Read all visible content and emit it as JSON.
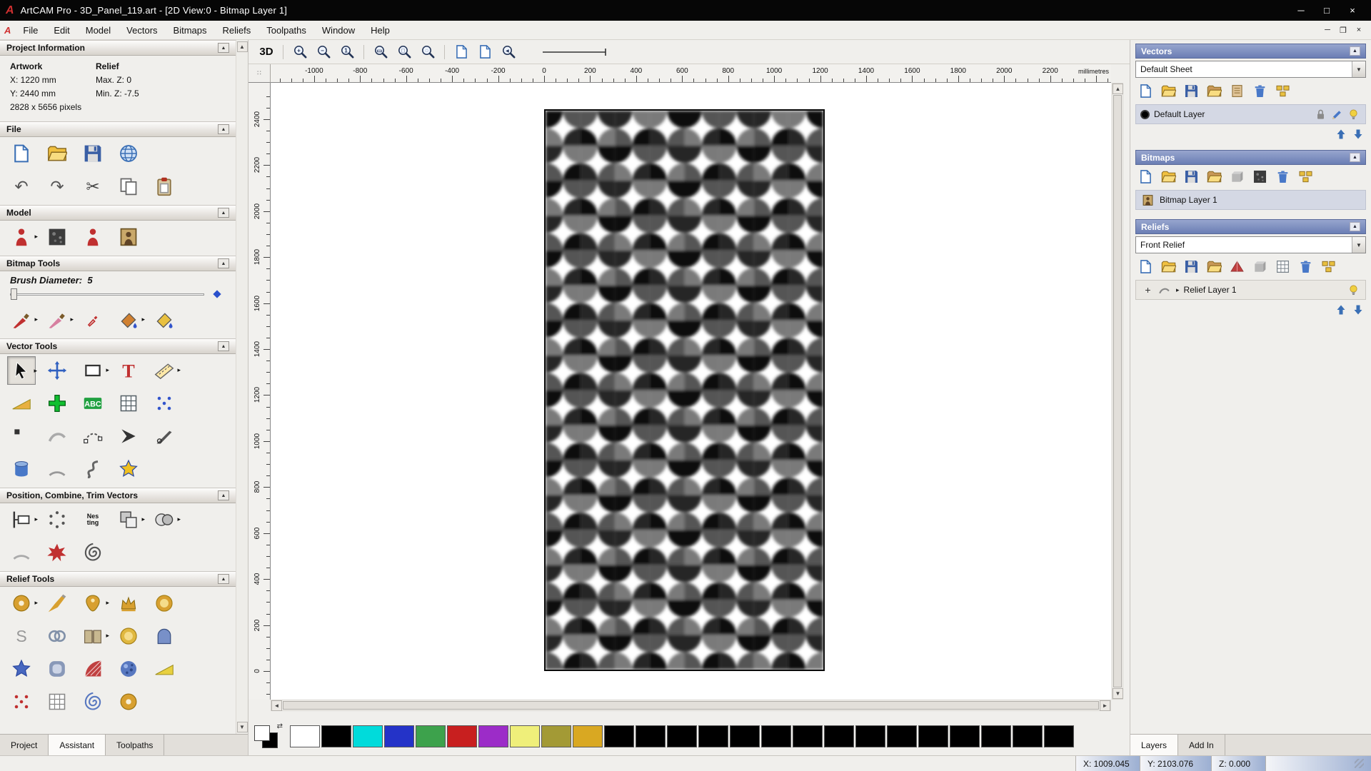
{
  "ui": {
    "collapse_glyph": "▲",
    "dropdown_arrow": "▼",
    "expander_arrow": "▸",
    "flyout_arrow": "▸",
    "scroll_up": "▲",
    "scroll_down": "▼",
    "scroll_left": "◄",
    "scroll_right": "►",
    "corner_glyph": "∷",
    "link_glyph": "⇄"
  },
  "window": {
    "title": "ArtCAM Pro - 3D_Panel_119.art - [2D View:0 - Bitmap Layer 1]",
    "logo_text": "A",
    "controls": [
      {
        "name": "minimize-button",
        "glyph": "─"
      },
      {
        "name": "maximize-button",
        "glyph": "□"
      },
      {
        "name": "close-button",
        "glyph": "×"
      }
    ],
    "mdi_controls": [
      {
        "name": "mdi-minimize-button",
        "glyph": "─"
      },
      {
        "name": "mdi-restore-button",
        "glyph": "❐"
      },
      {
        "name": "mdi-close-button",
        "glyph": "×"
      }
    ]
  },
  "menu": {
    "items": [
      "File",
      "Edit",
      "Model",
      "Vectors",
      "Bitmaps",
      "Reliefs",
      "Toolpaths",
      "Window",
      "Help"
    ]
  },
  "assistant": {
    "project_information": {
      "title": "Project Information",
      "artwork_header": "Artwork",
      "relief_header": "Relief",
      "artwork_x": "X: 1220 mm",
      "artwork_y": "Y: 2440 mm",
      "artwork_pixels": "2828 x 5656 pixels",
      "relief_max_z": "Max. Z: 0",
      "relief_min_z": "Min. Z: -7.5"
    },
    "file": {
      "title": "File",
      "rows": [
        [
          {
            "n": "new-model-button",
            "k": "file",
            "c": "#3a6fb5"
          },
          {
            "n": "open-model-button",
            "k": "folder",
            "c": "#f0c040"
          },
          {
            "n": "save-model-button",
            "k": "floppy",
            "c": "#3a5fa5"
          },
          {
            "n": "export-model-button",
            "k": "globe",
            "c": "#3a6fb5"
          }
        ],
        [
          {
            "n": "undo-button",
            "g": "↶",
            "c": "#555555"
          },
          {
            "n": "redo-button",
            "g": "↷",
            "c": "#555555"
          },
          {
            "n": "cut-button",
            "g": "✂",
            "c": "#444444"
          },
          {
            "n": "copy-button",
            "k": "copy",
            "c": "#666666"
          },
          {
            "n": "paste-button",
            "k": "clip",
            "c": "#b03020"
          }
        ]
      ]
    },
    "model": {
      "title": "Model",
      "rows": [
        [
          {
            "n": "greyscale-from-model-button",
            "k": "person",
            "c": "#c03030",
            "fly": true
          },
          {
            "n": "texture-relief-button",
            "k": "texture"
          },
          {
            "n": "shape-editor-button",
            "k": "person",
            "c": "#c03030"
          },
          {
            "n": "bitmap-from-model-button",
            "k": "portrait"
          }
        ]
      ]
    },
    "bitmap_tools": {
      "title": "Bitmap Tools",
      "brush_diameter_label": "Brush Diameter:",
      "brush_diameter_value": "5",
      "rows": [
        [
          {
            "n": "paint-tool",
            "k": "brush",
            "c": "#c03030",
            "fly": true
          },
          {
            "n": "paint-selective-tool",
            "k": "brush",
            "c": "#d77fa0",
            "fly": true
          },
          {
            "n": "colour-picker-tool",
            "k": "dropper",
            "c": "#c03030",
            "sm": true
          },
          {
            "n": "flood-fill-tool",
            "k": "bucket",
            "c": "#d08030",
            "fly": true
          },
          {
            "n": "bucket-fill-tool",
            "k": "bucket",
            "c": "#e8c040"
          }
        ]
      ]
    },
    "vector_tools": {
      "title": "Vector Tools",
      "rows": [
        [
          {
            "n": "select-vectors-tool",
            "k": "cursor",
            "c": "#111111",
            "fly": true,
            "active": true
          },
          {
            "n": "transform-vectors-tool",
            "k": "movecross",
            "c": "#3060c0"
          },
          {
            "n": "create-rectangle-tool",
            "k": "rect",
            "c": "#333333",
            "fly": true
          },
          {
            "n": "create-text-tool",
            "k": "texttool",
            "c": "#c03030",
            "label": "T"
          },
          {
            "n": "measure-tool",
            "k": "measure",
            "c": "#666666",
            "fly": true
          }
        ],
        [
          {
            "n": "offset-vectors-tool",
            "k": "wedge",
            "c": "#e8b040"
          },
          {
            "n": "create-cross-tool",
            "k": "plus",
            "c": "#10c030"
          },
          {
            "n": "convert-text-to-vectors-tool",
            "k": "abc",
            "c": "#20a040",
            "label": "ABC"
          },
          {
            "n": "snap-grid-tool",
            "k": "grid",
            "c": "#556066"
          },
          {
            "n": "create-polygon-tool",
            "k": "dots",
            "c": "#3355cc"
          }
        ],
        [
          {
            "n": "create-point-tool",
            "k": "smalldot",
            "c": "#333333"
          },
          {
            "n": "freehand-curve-tool",
            "k": "ghostcurve",
            "c": "#aaaaaa"
          },
          {
            "n": "bezier-curve-tool",
            "k": "nodeedit",
            "c": "#555555"
          },
          {
            "n": "create-polyline-tool",
            "k": "polyline",
            "c": "#333333"
          },
          {
            "n": "knife-tool",
            "k": "knife",
            "c": "#555555"
          }
        ],
        [
          {
            "n": "extrude-tool",
            "k": "cylinder",
            "c": "#4878c8"
          },
          {
            "n": "create-arc-tool",
            "k": "arc",
            "c": "#999999"
          },
          {
            "n": "node-editing-tool",
            "k": "scurve",
            "c": "#666666"
          },
          {
            "n": "create-star-tool",
            "k": "star",
            "c": "#f0c020"
          }
        ]
      ]
    },
    "position_tools": {
      "title": "Position, Combine, Trim Vectors",
      "rows": [
        [
          {
            "n": "position-vectors-tool",
            "k": "posl",
            "c": "#333333",
            "fly": true
          },
          {
            "n": "circular-copy-tool",
            "k": "dotcircle",
            "c": "#555555"
          },
          {
            "n": "nesting-tool",
            "k": "nesting",
            "label": "Nes\nting"
          },
          {
            "n": "combine-vectors-tool",
            "k": "combine",
            "fly": true
          },
          {
            "n": "weld-vectors-tool",
            "k": "weld",
            "fly": true
          }
        ],
        [
          {
            "n": "fit-arcs-tool",
            "k": "arc",
            "c": "#aaaaaa"
          },
          {
            "n": "vector-doctor-tool",
            "k": "doctor",
            "c": "#c03030"
          },
          {
            "n": "create-spiral-tool",
            "k": "spiral",
            "c": "#555555"
          }
        ]
      ]
    },
    "relief_tools": {
      "title": "Relief Tools",
      "rows": [
        [
          {
            "n": "texture-relief-wizard",
            "k": "donut",
            "c": "#d8a030",
            "fly": true
          },
          {
            "n": "sculpting-tool",
            "k": "chisel",
            "c": "#d8a030"
          },
          {
            "n": "shape-relief-tool",
            "k": "ornament",
            "c": "#d8a030",
            "fly": true
          },
          {
            "n": "crown-relief-tool",
            "k": "crown",
            "c": "#d8a030"
          },
          {
            "n": "emboss-relief-tool",
            "k": "button",
            "c": "#d8a030"
          }
        ],
        [
          {
            "n": "smooth-relief-tool",
            "g": "S",
            "c": "#999999"
          },
          {
            "n": "weave-relief-tool",
            "k": "knot",
            "c": "#8090a8"
          },
          {
            "n": "offset-relief-tool",
            "k": "book",
            "c": "#c8b890",
            "fly": true
          },
          {
            "n": "dome-relief-tool",
            "k": "button",
            "c": "#e0b840"
          },
          {
            "n": "turn-relief-tool",
            "k": "arch",
            "c": "#7890c8"
          }
        ],
        [
          {
            "n": "star-relief-tool",
            "k": "star",
            "c": "#4868c0"
          },
          {
            "n": "cushion-relief-tool",
            "k": "cushion",
            "c": "#8898b8"
          },
          {
            "n": "fan-relief-tool",
            "k": "fan",
            "c": "#c04040"
          },
          {
            "n": "texture-sphere-tool",
            "k": "sphere",
            "c": "#5878c0"
          },
          {
            "n": "wedge-relief-tool",
            "k": "wedge",
            "c": "#e8d040"
          }
        ],
        [
          {
            "n": "scatter-relief-tool",
            "k": "dots",
            "c": "#c03030"
          },
          {
            "n": "mesh-relief-tool",
            "k": "grid",
            "c": "#888888"
          },
          {
            "n": "swirl-relief-tool",
            "k": "spiral",
            "c": "#5878c0"
          },
          {
            "n": "ornament-relief-tool",
            "k": "donut",
            "c": "#d8a030"
          }
        ]
      ]
    },
    "tabs": [
      {
        "name": "tab-project",
        "label": "Project"
      },
      {
        "name": "tab-assistant",
        "label": "Assistant",
        "active": true
      },
      {
        "name": "tab-toolpaths",
        "label": "Toolpaths"
      }
    ]
  },
  "view_toolbar": {
    "buttons": [
      {
        "n": "view-3d-button",
        "label": "3D"
      },
      {
        "sep": true
      },
      {
        "n": "zoom-in-button",
        "k": "mag",
        "t": "+"
      },
      {
        "n": "zoom-out-button",
        "k": "mag",
        "t": "−"
      },
      {
        "n": "zoom-1to1-button",
        "k": "mag",
        "t": "1"
      },
      {
        "sep": true
      },
      {
        "n": "zoom-page-button",
        "k": "mag",
        "t": "▭"
      },
      {
        "n": "zoom-objects-button",
        "k": "mag",
        "t": "□"
      },
      {
        "n": "zoom-selection-button",
        "k": "mag",
        "t": "◌"
      },
      {
        "sep": true
      },
      {
        "n": "previous-view-button",
        "k": "file",
        "c": "#3a6fb5"
      },
      {
        "n": "next-view-button",
        "k": "file",
        "c": "#3a6fb5"
      },
      {
        "n": "zoom-back-button",
        "k": "mag",
        "t": "◂"
      }
    ]
  },
  "rulers": {
    "unit": "millimetres",
    "horizontal_labels": [
      -1000,
      -800,
      -600,
      -400,
      -200,
      0,
      200,
      400,
      600,
      800,
      1000,
      1200,
      1400,
      1600,
      1800,
      2000,
      2200
    ],
    "vertical_labels": [
      2400,
      2200,
      2000,
      1800,
      1600,
      1400,
      1200,
      1000,
      800,
      600,
      400,
      200,
      0
    ]
  },
  "canvas": {
    "pattern_colors": [
      "#0d0d0d",
      "#555555",
      "#262626",
      "#7a7a7a"
    ]
  },
  "palette": {
    "swatches": [
      "#ffffff",
      "#000000",
      "#00dbdb",
      "#2433c8",
      "#3da24c",
      "#c81f1f",
      "#9c2cc8",
      "#efef7a",
      "#a39a35",
      "#d9a822",
      "#000000",
      "#000000",
      "#000000",
      "#000000",
      "#000000",
      "#000000",
      "#000000",
      "#000000",
      "#000000",
      "#000000",
      "#000000",
      "#000000",
      "#000000",
      "#000000",
      "#000000"
    ]
  },
  "panels": {
    "vectors": {
      "title": "Vectors",
      "sheet_value": "Default Sheet",
      "toolbar": [
        {
          "n": "new-vector-layer-button",
          "k": "file",
          "c": "#3a6fb5"
        },
        {
          "n": "open-vector-layer-button",
          "k": "folder",
          "c": "#f0c040"
        },
        {
          "n": "save-vector-layer-button",
          "k": "floppy",
          "c": "#3a5fa5"
        },
        {
          "n": "import-vector-layer-button",
          "k": "folder",
          "c": "#c89858"
        },
        {
          "n": "export-vector-layer-button",
          "k": "pagetan",
          "c": "#e0c498"
        },
        {
          "n": "delete-vector-layer-button",
          "k": "trash",
          "c": "#4878c8"
        },
        {
          "n": "merge-vector-layers-button",
          "k": "merge",
          "c": "#e8c040"
        }
      ],
      "layer": {
        "label": "Default Layer",
        "swatch": "#000000"
      },
      "layer_icons": [
        {
          "n": "lock-vector-layer-icon",
          "k": "lock",
          "c": "#8a8a8a"
        },
        {
          "n": "edit-vector-layer-icon",
          "k": "pencil",
          "c": "#4878c8"
        },
        {
          "n": "vector-layer-visibility-icon",
          "k": "bulb",
          "c": "#f0d040"
        }
      ],
      "reorder": [
        {
          "n": "move-vector-layer-up-button",
          "k": "uarrow",
          "c": "#3a6fb5"
        },
        {
          "n": "move-vector-layer-down-button",
          "k": "darrow",
          "c": "#3a6fb5"
        }
      ]
    },
    "bitmaps": {
      "title": "Bitmaps",
      "toolbar": [
        {
          "n": "new-bitmap-layer-button",
          "k": "file",
          "c": "#3a6fb5"
        },
        {
          "n": "open-bitmap-layer-button",
          "k": "folder",
          "c": "#f0c040"
        },
        {
          "n": "save-bitmap-layer-button",
          "k": "floppy",
          "c": "#3a5fa5"
        },
        {
          "n": "import-bitmap-layer-button",
          "k": "folder",
          "c": "#c89858"
        },
        {
          "n": "adjust-bitmap-layer-button",
          "k": "cube",
          "c": "#b8b8b8"
        },
        {
          "n": "contrast-bitmap-layer-button",
          "k": "texture"
        },
        {
          "n": "delete-bitmap-layer-button",
          "k": "trash",
          "c": "#4878c8"
        },
        {
          "n": "merge-bitmap-layers-button",
          "k": "merge",
          "c": "#e8c040"
        }
      ],
      "layer_thumb": [
        {
          "n": "bitmap-layer-thumbnail",
          "k": "portrait"
        }
      ],
      "layer": {
        "label": "Bitmap Layer 1"
      }
    },
    "reliefs": {
      "title": "Reliefs",
      "relief_value": "Front Relief",
      "toolbar": [
        {
          "n": "new-relief-layer-button",
          "k": "file",
          "c": "#3a6fb5"
        },
        {
          "n": "open-relief-layer-button",
          "k": "folder",
          "c": "#f0c040"
        },
        {
          "n": "save-relief-layer-button",
          "k": "floppy",
          "c": "#3a5fa5"
        },
        {
          "n": "import-relief-layer-button",
          "k": "folder",
          "c": "#c89858"
        },
        {
          "n": "roof-relief-layer-button",
          "k": "pyramid",
          "c": "#c04040"
        },
        {
          "n": "box-relief-layer-button",
          "k": "cube",
          "c": "#b8b8b8"
        },
        {
          "n": "mesh-relief-layer-button",
          "k": "grid",
          "c": "#778088"
        },
        {
          "n": "delete-relief-layer-button",
          "k": "trash",
          "c": "#4878c8"
        },
        {
          "n": "merge-relief-layers-button",
          "k": "merge",
          "c": "#e8c040"
        }
      ],
      "layer_left": [
        {
          "n": "add-relief-layer-icon",
          "g": "+",
          "c": "#333333"
        },
        {
          "n": "relief-layer-thumbnail",
          "k": "ghostcurve",
          "c": "#888888"
        }
      ],
      "layer": {
        "label": "Relief Layer 1"
      },
      "layer_icons": [
        {
          "n": "relief-layer-visibility-icon",
          "k": "bulb",
          "c": "#f0d040"
        }
      ],
      "reorder": [
        {
          "n": "move-relief-layer-up-button",
          "k": "uarrow",
          "c": "#3a6fb5"
        },
        {
          "n": "move-relief-layer-down-button",
          "k": "darrow",
          "c": "#3a6fb5"
        }
      ]
    },
    "tabs": [
      {
        "name": "tab-layers",
        "label": "Layers",
        "active": true
      },
      {
        "name": "tab-addin",
        "label": "Add In"
      }
    ]
  },
  "status_bar": {
    "x": "X: 1009.045",
    "y": "Y: 2103.076",
    "z": "Z: 0.000"
  }
}
